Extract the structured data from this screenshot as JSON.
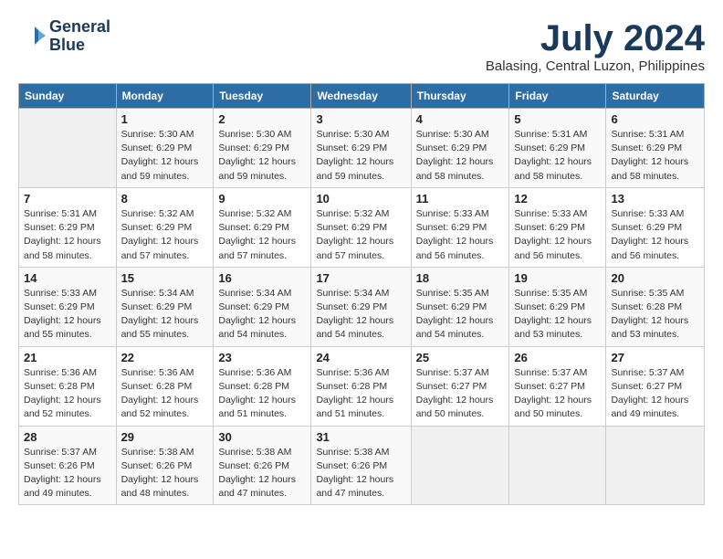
{
  "header": {
    "logo_line1": "General",
    "logo_line2": "Blue",
    "month": "July 2024",
    "location": "Balasing, Central Luzon, Philippines"
  },
  "weekdays": [
    "Sunday",
    "Monday",
    "Tuesday",
    "Wednesday",
    "Thursday",
    "Friday",
    "Saturday"
  ],
  "weeks": [
    [
      {
        "day": "",
        "info": ""
      },
      {
        "day": "1",
        "info": "Sunrise: 5:30 AM\nSunset: 6:29 PM\nDaylight: 12 hours\nand 59 minutes."
      },
      {
        "day": "2",
        "info": "Sunrise: 5:30 AM\nSunset: 6:29 PM\nDaylight: 12 hours\nand 59 minutes."
      },
      {
        "day": "3",
        "info": "Sunrise: 5:30 AM\nSunset: 6:29 PM\nDaylight: 12 hours\nand 59 minutes."
      },
      {
        "day": "4",
        "info": "Sunrise: 5:30 AM\nSunset: 6:29 PM\nDaylight: 12 hours\nand 58 minutes."
      },
      {
        "day": "5",
        "info": "Sunrise: 5:31 AM\nSunset: 6:29 PM\nDaylight: 12 hours\nand 58 minutes."
      },
      {
        "day": "6",
        "info": "Sunrise: 5:31 AM\nSunset: 6:29 PM\nDaylight: 12 hours\nand 58 minutes."
      }
    ],
    [
      {
        "day": "7",
        "info": "Sunrise: 5:31 AM\nSunset: 6:29 PM\nDaylight: 12 hours\nand 58 minutes."
      },
      {
        "day": "8",
        "info": "Sunrise: 5:32 AM\nSunset: 6:29 PM\nDaylight: 12 hours\nand 57 minutes."
      },
      {
        "day": "9",
        "info": "Sunrise: 5:32 AM\nSunset: 6:29 PM\nDaylight: 12 hours\nand 57 minutes."
      },
      {
        "day": "10",
        "info": "Sunrise: 5:32 AM\nSunset: 6:29 PM\nDaylight: 12 hours\nand 57 minutes."
      },
      {
        "day": "11",
        "info": "Sunrise: 5:33 AM\nSunset: 6:29 PM\nDaylight: 12 hours\nand 56 minutes."
      },
      {
        "day": "12",
        "info": "Sunrise: 5:33 AM\nSunset: 6:29 PM\nDaylight: 12 hours\nand 56 minutes."
      },
      {
        "day": "13",
        "info": "Sunrise: 5:33 AM\nSunset: 6:29 PM\nDaylight: 12 hours\nand 56 minutes."
      }
    ],
    [
      {
        "day": "14",
        "info": "Sunrise: 5:33 AM\nSunset: 6:29 PM\nDaylight: 12 hours\nand 55 minutes."
      },
      {
        "day": "15",
        "info": "Sunrise: 5:34 AM\nSunset: 6:29 PM\nDaylight: 12 hours\nand 55 minutes."
      },
      {
        "day": "16",
        "info": "Sunrise: 5:34 AM\nSunset: 6:29 PM\nDaylight: 12 hours\nand 54 minutes."
      },
      {
        "day": "17",
        "info": "Sunrise: 5:34 AM\nSunset: 6:29 PM\nDaylight: 12 hours\nand 54 minutes."
      },
      {
        "day": "18",
        "info": "Sunrise: 5:35 AM\nSunset: 6:29 PM\nDaylight: 12 hours\nand 54 minutes."
      },
      {
        "day": "19",
        "info": "Sunrise: 5:35 AM\nSunset: 6:29 PM\nDaylight: 12 hours\nand 53 minutes."
      },
      {
        "day": "20",
        "info": "Sunrise: 5:35 AM\nSunset: 6:28 PM\nDaylight: 12 hours\nand 53 minutes."
      }
    ],
    [
      {
        "day": "21",
        "info": "Sunrise: 5:36 AM\nSunset: 6:28 PM\nDaylight: 12 hours\nand 52 minutes."
      },
      {
        "day": "22",
        "info": "Sunrise: 5:36 AM\nSunset: 6:28 PM\nDaylight: 12 hours\nand 52 minutes."
      },
      {
        "day": "23",
        "info": "Sunrise: 5:36 AM\nSunset: 6:28 PM\nDaylight: 12 hours\nand 51 minutes."
      },
      {
        "day": "24",
        "info": "Sunrise: 5:36 AM\nSunset: 6:28 PM\nDaylight: 12 hours\nand 51 minutes."
      },
      {
        "day": "25",
        "info": "Sunrise: 5:37 AM\nSunset: 6:27 PM\nDaylight: 12 hours\nand 50 minutes."
      },
      {
        "day": "26",
        "info": "Sunrise: 5:37 AM\nSunset: 6:27 PM\nDaylight: 12 hours\nand 50 minutes."
      },
      {
        "day": "27",
        "info": "Sunrise: 5:37 AM\nSunset: 6:27 PM\nDaylight: 12 hours\nand 49 minutes."
      }
    ],
    [
      {
        "day": "28",
        "info": "Sunrise: 5:37 AM\nSunset: 6:26 PM\nDaylight: 12 hours\nand 49 minutes."
      },
      {
        "day": "29",
        "info": "Sunrise: 5:38 AM\nSunset: 6:26 PM\nDaylight: 12 hours\nand 48 minutes."
      },
      {
        "day": "30",
        "info": "Sunrise: 5:38 AM\nSunset: 6:26 PM\nDaylight: 12 hours\nand 47 minutes."
      },
      {
        "day": "31",
        "info": "Sunrise: 5:38 AM\nSunset: 6:26 PM\nDaylight: 12 hours\nand 47 minutes."
      },
      {
        "day": "",
        "info": ""
      },
      {
        "day": "",
        "info": ""
      },
      {
        "day": "",
        "info": ""
      }
    ]
  ]
}
